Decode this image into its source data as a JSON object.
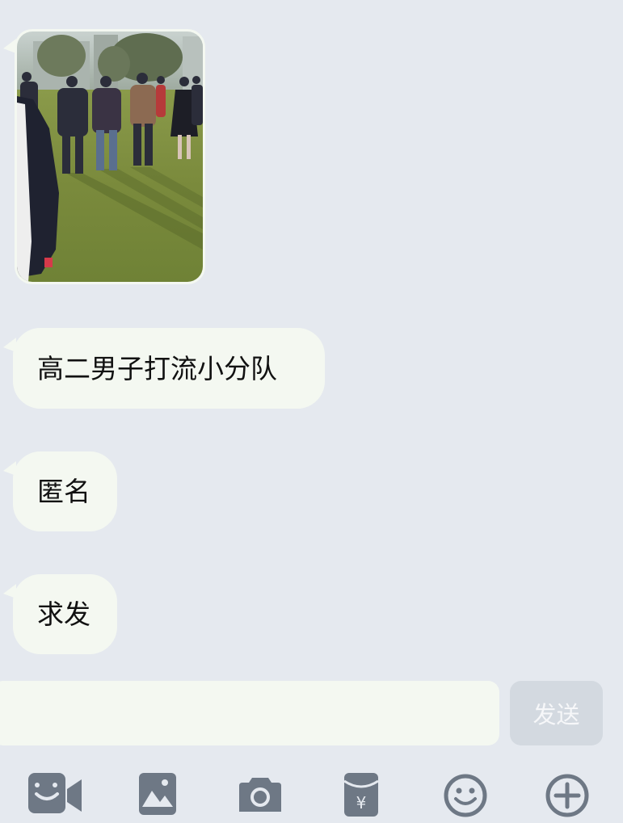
{
  "chat": {
    "messages": [
      {
        "type": "image",
        "alt": ""
      },
      {
        "type": "text",
        "text": "高二男子打流小分队"
      },
      {
        "type": "text",
        "text": "匿名"
      },
      {
        "type": "text",
        "text": "求发"
      }
    ]
  },
  "composer": {
    "input_value": "",
    "input_placeholder": "",
    "send_label": "发送"
  },
  "toolbar": {
    "icons": [
      "video-call-icon",
      "photo-album-icon",
      "camera-icon",
      "red-packet-icon",
      "emoji-icon",
      "plus-icon"
    ]
  },
  "colors": {
    "background": "#e5e9ef",
    "bubble": "#f4f8f1",
    "send_button": "#d3d9e0",
    "icon": "#6e7885"
  }
}
